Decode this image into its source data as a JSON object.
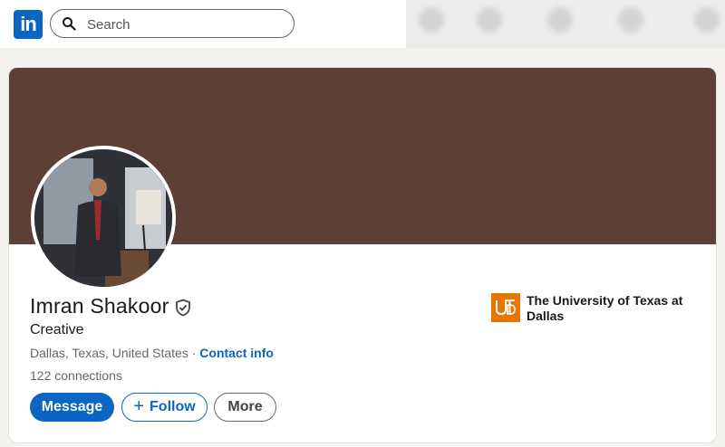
{
  "nav": {
    "logo_text": "in",
    "search_placeholder": "Search"
  },
  "profile": {
    "name": "Imran Shakoor",
    "headline": "Creative",
    "location": "Dallas, Texas, United States",
    "separator": " · ",
    "contact_label": "Contact info",
    "connections": "122 connections"
  },
  "actions": {
    "message": "Message",
    "follow": "Follow",
    "more": "More"
  },
  "education": {
    "school": "The University of Texas at Dallas"
  },
  "colors": {
    "brand": "#0a66c2",
    "banner": "#5c3f35",
    "school_logo": "#e87500"
  }
}
